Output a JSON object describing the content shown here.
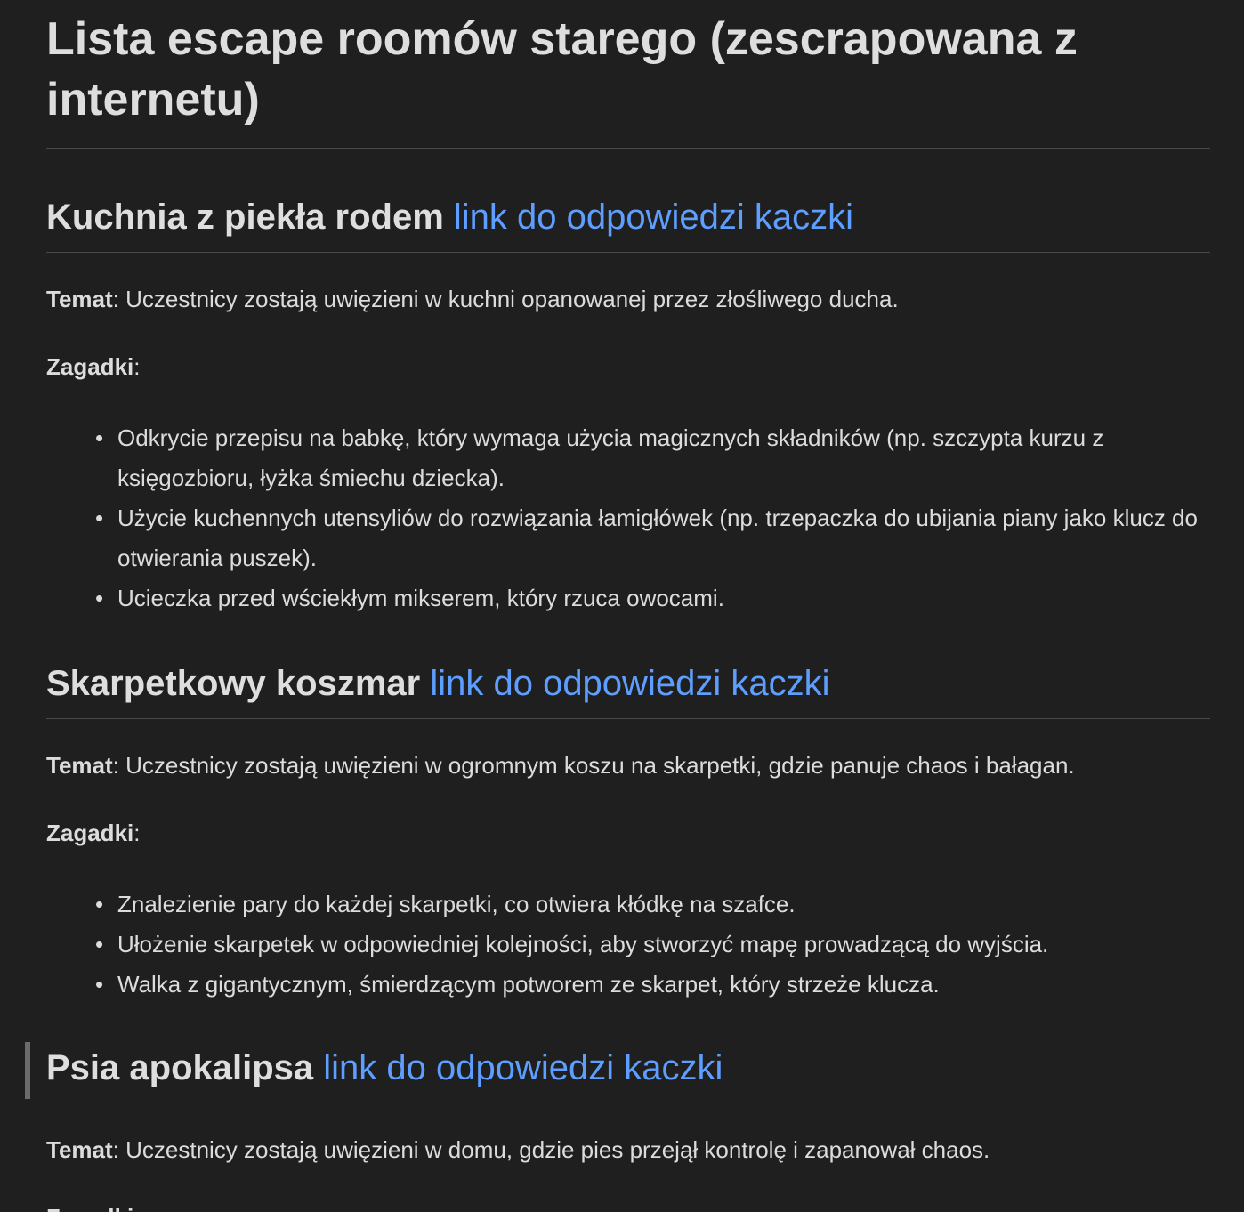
{
  "title": "Lista escape roomów starego (zescrapowana z internetu)",
  "link_text": "link do odpowiedzi kaczki",
  "label_theme": "Temat",
  "label_puzzles": "Zagadki",
  "colors": {
    "background": "#1f1f20",
    "text": "#dcdcdc",
    "link": "#5e9eff",
    "divider": "#4a4a4c"
  },
  "sections": [
    {
      "heading": "Kuchnia z piekła rodem",
      "theme": "Uczestnicy zostają uwięzieni w kuchni opanowanej przez złośliwego ducha.",
      "puzzles": [
        "Odkrycie przepisu na babkę, który wymaga użycia magicznych składników (np. szczypta kurzu z księgozbioru, łyżka śmiechu dziecka).",
        "Użycie kuchennych utensyliów do rozwiązania łamigłówek (np. trzepaczka do ubijania piany jako klucz do otwierania puszek).",
        "Ucieczka przed wściekłym mikserem, który rzuca owocami."
      ]
    },
    {
      "heading": "Skarpetkowy koszmar",
      "theme": "Uczestnicy zostają uwięzieni w ogromnym koszu na skarpetki, gdzie panuje chaos i bałagan.",
      "puzzles": [
        "Znalezienie pary do każdej skarpetki, co otwiera kłódkę na szafce.",
        "Ułożenie skarpetek w odpowiedniej kolejności, aby stworzyć mapę prowadzącą do wyjścia.",
        "Walka z gigantycznym, śmierdzącym potworem ze skarpet, który strzeże klucza."
      ]
    },
    {
      "heading": "Psia apokalipsa",
      "theme": "Uczestnicy zostają uwięzieni w domu, gdzie pies przejął kontrolę i zapanował chaos.",
      "puzzles_partial": "Zagadki"
    }
  ]
}
